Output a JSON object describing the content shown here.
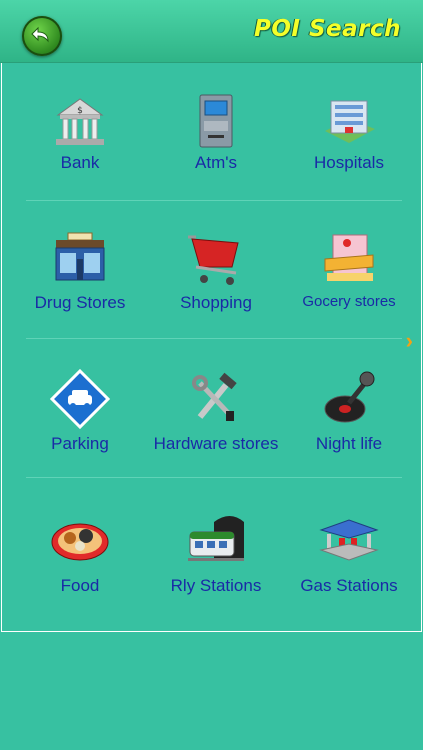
{
  "header": {
    "title": "POI Search"
  },
  "categories": [
    {
      "label": "Bank",
      "icon": "bank-icon"
    },
    {
      "label": "Atm's",
      "icon": "atm-icon"
    },
    {
      "label": "Hospitals",
      "icon": "hospital-icon"
    },
    {
      "label": "Drug Stores",
      "icon": "drug-store-icon"
    },
    {
      "label": "Shopping",
      "icon": "shopping-cart-icon"
    },
    {
      "label": "Gocery stores",
      "icon": "grocery-store-icon"
    },
    {
      "label": "Parking",
      "icon": "parking-icon"
    },
    {
      "label": "Hardware stores",
      "icon": "hardware-tools-icon"
    },
    {
      "label": "Night life",
      "icon": "microphone-icon"
    },
    {
      "label": "Food",
      "icon": "food-platter-icon"
    },
    {
      "label": "Rly Stations",
      "icon": "train-icon"
    },
    {
      "label": "Gas Stations",
      "icon": "gas-station-icon"
    }
  ],
  "colors": {
    "background": "#37c1a1",
    "label": "#1a2aa6",
    "title": "#f4ff2a",
    "arrow": "#f0a218"
  }
}
